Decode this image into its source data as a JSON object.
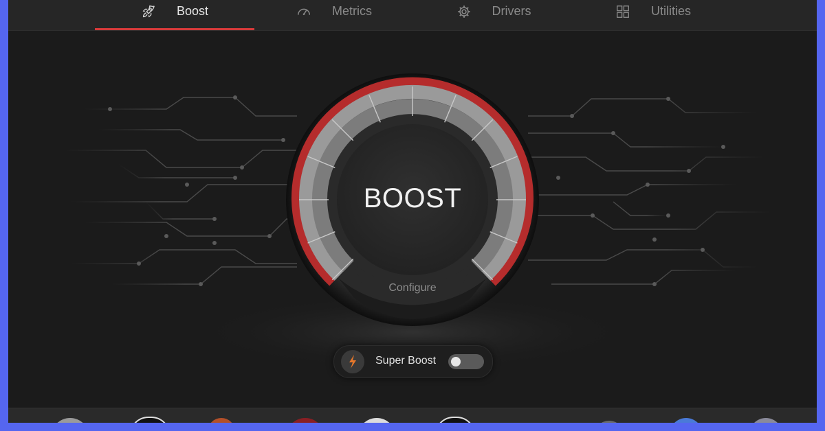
{
  "tabs": [
    {
      "label": "Boost",
      "icon": "rocket-icon",
      "active": true
    },
    {
      "label": "Metrics",
      "icon": "speedometer-icon",
      "active": false
    },
    {
      "label": "Drivers",
      "icon": "gear-icon",
      "active": false
    },
    {
      "label": "Utilities",
      "icon": "grid-icon",
      "active": false
    }
  ],
  "gauge": {
    "title": "BOOST",
    "configure_label": "Configure"
  },
  "super_boost": {
    "label": "Super Boost",
    "icon": "lightning-icon",
    "enabled": false
  },
  "dock": {
    "items": [
      "app-1",
      "app-2",
      "app-3",
      "app-4",
      "app-5",
      "app-6",
      "app-7",
      "app-8",
      "app-9",
      "app-10"
    ]
  },
  "colors": {
    "accent": "#d83a3a",
    "background": "#1b1b1b",
    "frame": "#5566f0",
    "bolt": "#e8782a"
  }
}
